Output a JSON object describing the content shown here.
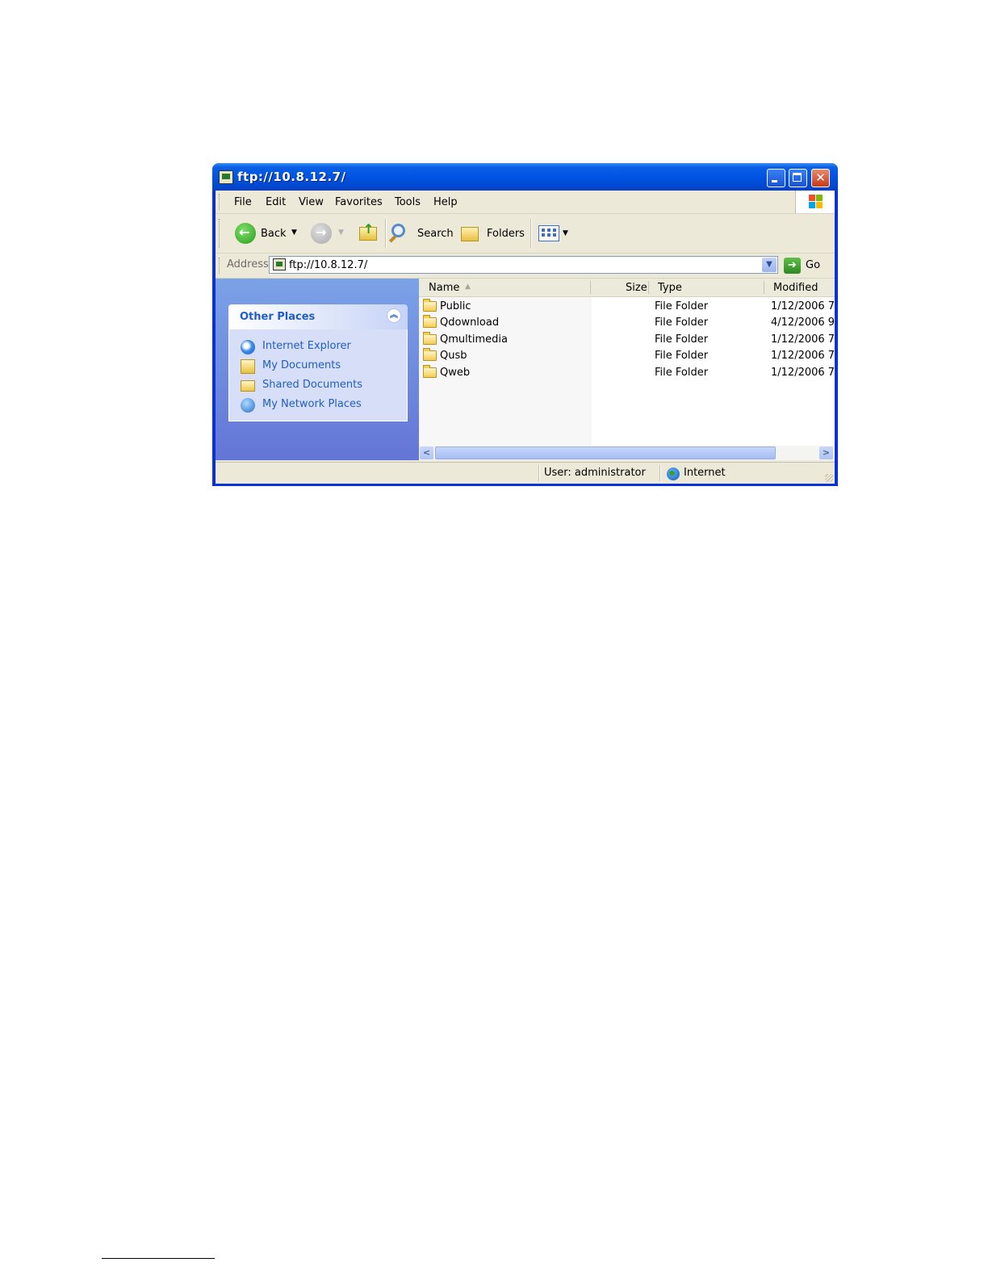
{
  "window": {
    "title": "ftp://10.8.12.7/"
  },
  "menubar": {
    "items": [
      "File",
      "Edit",
      "View",
      "Favorites",
      "Tools",
      "Help"
    ]
  },
  "toolbar": {
    "back_label": "Back",
    "search_label": "Search",
    "folders_label": "Folders"
  },
  "address": {
    "label": "Address",
    "value": "ftp://10.8.12.7/",
    "go_label": "Go"
  },
  "taskpane": {
    "panel_title": "Other Places",
    "places": [
      {
        "label": "Internet Explorer",
        "icon": "internet-explorer-icon"
      },
      {
        "label": "My Documents",
        "icon": "my-documents-icon"
      },
      {
        "label": "Shared Documents",
        "icon": "shared-documents-icon"
      },
      {
        "label": "My Network Places",
        "icon": "network-places-icon"
      }
    ]
  },
  "filelist": {
    "columns": {
      "name": "Name",
      "size": "Size",
      "type": "Type",
      "modified": "Modified"
    },
    "rows": [
      {
        "name": "Public",
        "size": "",
        "type": "File Folder",
        "modified": "1/12/2006 7:"
      },
      {
        "name": "Qdownload",
        "size": "",
        "type": "File Folder",
        "modified": "4/12/2006 9:"
      },
      {
        "name": "Qmultimedia",
        "size": "",
        "type": "File Folder",
        "modified": "1/12/2006 7:"
      },
      {
        "name": "Qusb",
        "size": "",
        "type": "File Folder",
        "modified": "1/12/2006 7:"
      },
      {
        "name": "Qweb",
        "size": "",
        "type": "File Folder",
        "modified": "1/12/2006 7:"
      }
    ]
  },
  "statusbar": {
    "user": "User: administrator",
    "zone": "Internet"
  },
  "colors": {
    "titlebar": "#0054e3",
    "taskpane_link": "#215dc6",
    "taskpane_bg": "#7ba2e7"
  }
}
